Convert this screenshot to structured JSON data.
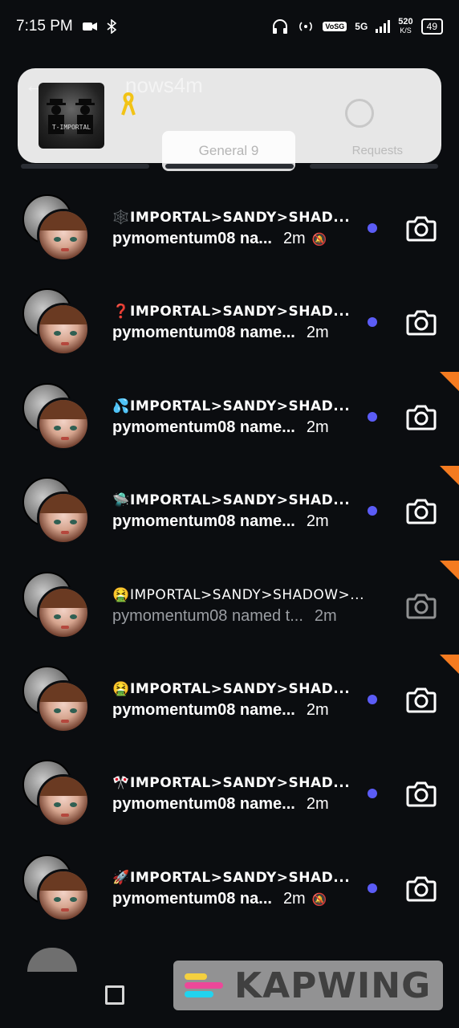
{
  "status_bar": {
    "time": "7:15 PM",
    "network_label": "5G",
    "volte_label": "VoSG",
    "speed_value": "520",
    "speed_unit": "K/S",
    "battery": "49"
  },
  "header": {
    "username_partial": "nows4m",
    "tabs": [
      {
        "label": "General 9"
      },
      {
        "label": "Requests"
      }
    ]
  },
  "overlay": {
    "thumb_text": "T-IMPORTAL",
    "ribbon_icon": "yellow-ribbon-icon"
  },
  "threads": [
    {
      "emoji": "🕸️",
      "title": "IMPORTAL>SANDY>SHAD...",
      "preview": "pymomentum08 na...",
      "age": "2m",
      "muted": true,
      "unread": true,
      "read": false
    },
    {
      "emoji": "❓",
      "title": "IMPORTAL>SANDY>SHAD...",
      "preview": "pymomentum08 name...",
      "age": "2m",
      "muted": false,
      "unread": true,
      "read": false
    },
    {
      "emoji": "💦",
      "title": "IMPORTAL>SANDY>SHAD...",
      "preview": "pymomentum08 name...",
      "age": "2m",
      "muted": false,
      "unread": true,
      "read": false
    },
    {
      "emoji": "🛸",
      "title": "IMPORTAL>SANDY>SHAD...",
      "preview": "pymomentum08 name...",
      "age": "2m",
      "muted": false,
      "unread": true,
      "read": false
    },
    {
      "emoji": "🤮",
      "title": "IMPORTAL>SANDY>SHADOW>...",
      "preview": "pymomentum08 named t...",
      "age": "2m",
      "muted": false,
      "unread": false,
      "read": true
    },
    {
      "emoji": "🤮",
      "title": "IMPORTAL>SANDY>SHAD...",
      "preview": "pymomentum08 name...",
      "age": "2m",
      "muted": false,
      "unread": true,
      "read": false
    },
    {
      "emoji": "🎌",
      "title": "IMPORTAL>SANDY>SHAD...",
      "preview": "pymomentum08 name...",
      "age": "2m",
      "muted": false,
      "unread": true,
      "read": false
    },
    {
      "emoji": "🚀",
      "title": "IMPORTAL>SANDY>SHAD...",
      "preview": "pymomentum08 na...",
      "age": "2m",
      "muted": true,
      "unread": true,
      "read": false
    }
  ],
  "watermark": {
    "text": "KAPWING"
  },
  "colors": {
    "unread_dot": "#5b5cf6",
    "accent_orange": "#f47b20",
    "background": "#0b0d10"
  }
}
